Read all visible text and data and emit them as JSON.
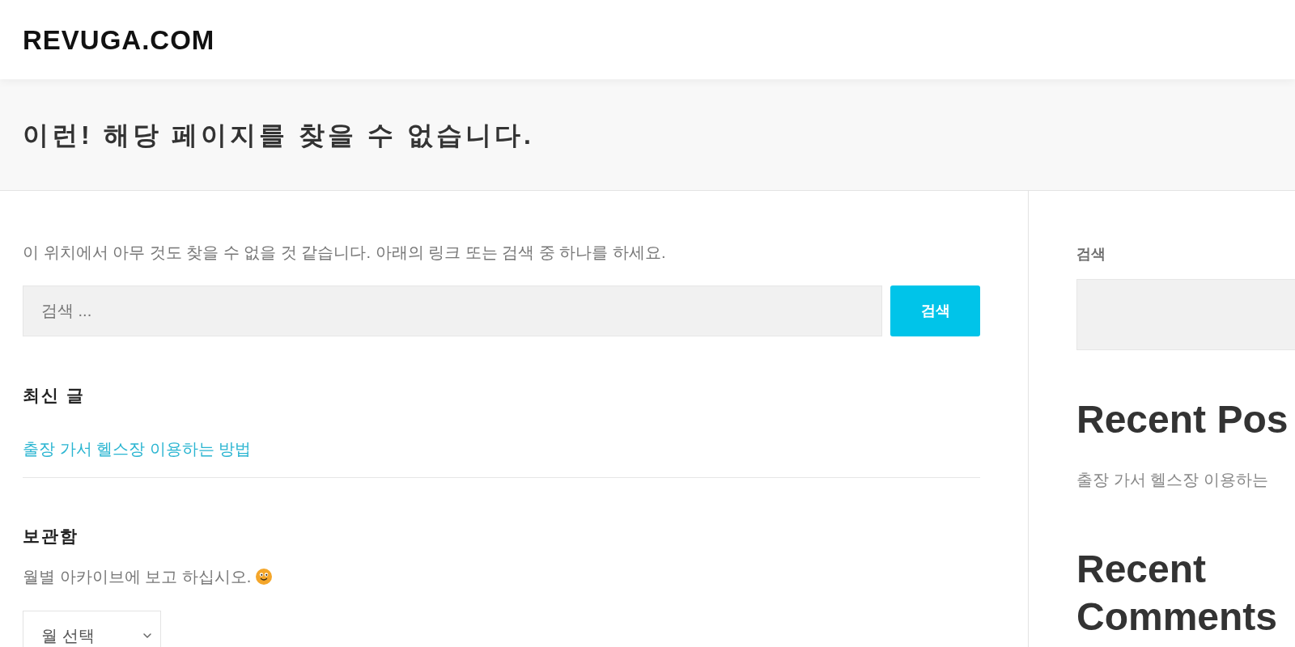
{
  "header": {
    "logo": "REVUGA.COM"
  },
  "page_title": "이런! 해당 페이지를 찾을 수 없습니다.",
  "main": {
    "message": "이 위치에서 아무 것도 찾을 수 없을 것 같습니다. 아래의 링크 또는 검색 중 하나를 하세요.",
    "search": {
      "placeholder": "검색 ...",
      "button": "검색"
    },
    "recent_posts": {
      "title": "최신 글",
      "items": [
        "출장 가서 헬스장 이용하는 방법"
      ]
    },
    "archives": {
      "title": "보관함",
      "text": "월별 아카이브에 보고 하십시오.",
      "select": {
        "value": "월 선택"
      }
    }
  },
  "sidebar": {
    "search": {
      "label": "검색"
    },
    "recent_posts": {
      "title": "Recent Pos",
      "items": [
        "출장 가서 헬스장 이용하는"
      ]
    },
    "recent_comments": {
      "title": "Recent Comments"
    }
  }
}
